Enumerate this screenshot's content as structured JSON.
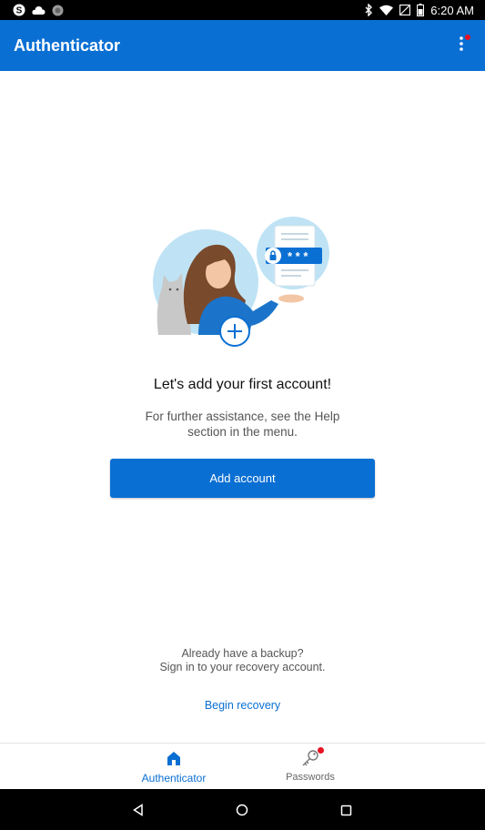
{
  "status_bar": {
    "time": "6:20 AM",
    "left_icons": [
      "skype-icon",
      "cloud-icon",
      "app-circle-icon"
    ],
    "right_icons": [
      "bluetooth-icon",
      "wifi-icon",
      "no-sim-icon",
      "battery-icon"
    ]
  },
  "app_bar": {
    "title": "Authenticator",
    "menu_icon": "more-vertical-icon",
    "menu_badge": true
  },
  "empty_state": {
    "headline": "Let's add your first account!",
    "subtext": "For further assistance, see the Help section in the menu.",
    "add_button_label": "Add account",
    "backup_line1": "Already have a backup?",
    "backup_line2": "Sign in to your recovery account.",
    "recovery_link": "Begin recovery"
  },
  "bottom_nav": {
    "items": [
      {
        "label": "Authenticator",
        "icon": "home-icon",
        "active": true
      },
      {
        "label": "Passwords",
        "icon": "key-icon",
        "active": false,
        "badge": true
      }
    ]
  },
  "system_nav": {
    "icons": [
      "back-icon",
      "home-circle-icon",
      "recents-icon"
    ]
  },
  "colors": {
    "primary": "#0a6fd3",
    "badge": "#e81123",
    "illustration_bg": "#bfe3f5"
  }
}
